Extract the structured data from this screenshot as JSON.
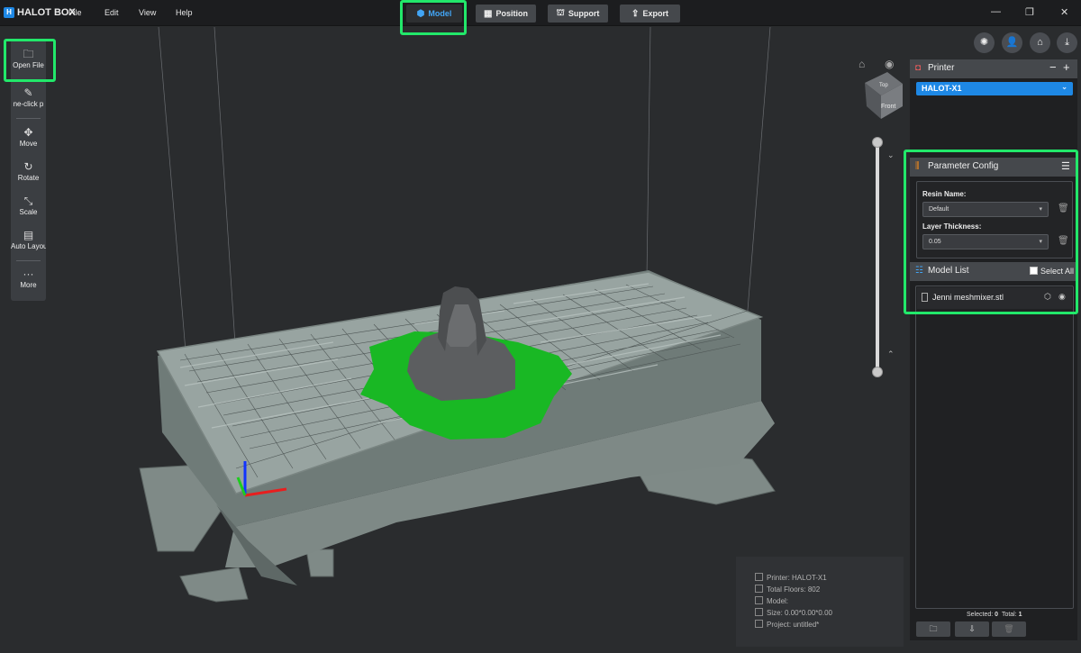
{
  "app": {
    "name": "HALOT BOX",
    "logo": "H"
  },
  "menu": [
    "File",
    "Edit",
    "View",
    "Help"
  ],
  "modes": [
    {
      "label": "Model",
      "icon": "cube-icon",
      "active": true
    },
    {
      "label": "Position",
      "icon": "grid-icon"
    },
    {
      "label": "Support",
      "icon": "support-icon"
    },
    {
      "label": "Export",
      "icon": "export-icon"
    }
  ],
  "window_controls": {
    "minimize": "—",
    "restore": "❐",
    "close": "✕"
  },
  "toolbar": [
    {
      "label": "Open File",
      "icon": "folder-icon",
      "glyph": "🗀"
    },
    {
      "label": "ne-click p",
      "icon": "magic-wand-icon",
      "glyph": "✎"
    },
    {
      "label": "Move",
      "icon": "move-icon",
      "glyph": "✥"
    },
    {
      "label": "Rotate",
      "icon": "rotate-icon",
      "glyph": "↻"
    },
    {
      "label": "Scale",
      "icon": "scale-icon",
      "glyph": "⤡"
    },
    {
      "label": "Auto Layout",
      "icon": "auto-layout-icon",
      "glyph": "▤"
    },
    {
      "label": "More",
      "icon": "more-icon",
      "glyph": "···"
    }
  ],
  "view_cube": {
    "top": "Top",
    "front": "Front"
  },
  "info": {
    "printer_label": "Printer:",
    "printer_value": "HALOT-X1",
    "floors_label": "Total Floors:",
    "floors_value": "802",
    "model_label": "Model:",
    "model_value": "",
    "size_label": "Size:",
    "size_value": "0.00*0.00*0.00",
    "project_label": "Project:",
    "project_value": "untitled*"
  },
  "printer_panel": {
    "title": "Printer",
    "selected": "HALOT-X1"
  },
  "param_panel": {
    "title": "Parameter Config",
    "resin_label": "Resin Name:",
    "resin_value": "Default",
    "layer_label": "Layer Thickness:",
    "layer_value": "0.05"
  },
  "model_list": {
    "title": "Model List",
    "select_all": "Select All",
    "items": [
      {
        "name": "Jenni meshmixer.stl"
      }
    ],
    "selected_label": "Selected:",
    "selected_count": "0",
    "total_label": "Total:",
    "total_count": "1"
  },
  "colors": {
    "accent": "#1e88e5",
    "highlight": "#22e86a",
    "plate": "#8f9b98",
    "model_shadow": "#19b824"
  }
}
